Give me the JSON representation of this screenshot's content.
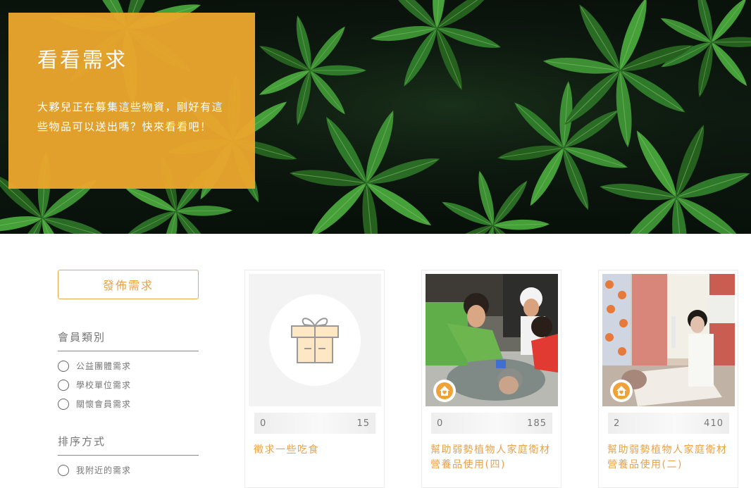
{
  "hero": {
    "title": "看看需求",
    "description": "大夥兒正在募集這些物資，剛好有這些物品可以送出嗎？快來看看吧！"
  },
  "sidebar": {
    "publish_button": "發佈需求",
    "member_type": {
      "title": "會員類別",
      "options": [
        "公益團體需求",
        "學校單位需求",
        "關懷會員需求"
      ]
    },
    "sort": {
      "title": "排序方式",
      "options": [
        "我附近的需求"
      ]
    }
  },
  "cards": [
    {
      "title": "徵求一些吃食",
      "stat_left": "0",
      "stat_right": "15",
      "image": "gift-placeholder",
      "badge": false
    },
    {
      "title": "幫助弱勢植物人家庭衛材營養品使用(四)",
      "stat_left": "0",
      "stat_right": "185",
      "image": "care-photo",
      "badge": true
    },
    {
      "title": "幫助弱勢植物人家庭衛材營養品使用(二)",
      "stat_left": "2",
      "stat_right": "410",
      "image": "hospital-photo",
      "badge": true
    }
  ],
  "colors": {
    "accent": "#e8a14a",
    "hero_card": "#eaa52d"
  }
}
